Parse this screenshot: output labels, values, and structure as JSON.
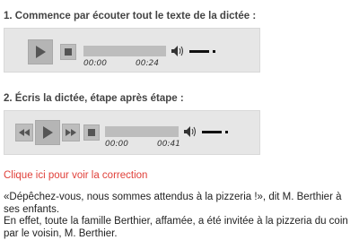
{
  "step1": {
    "heading": "1. Commence par écouter tout le texte de la dictée :",
    "player": {
      "current_time": "00:00",
      "duration": "00:24",
      "progress": 0
    }
  },
  "step2": {
    "heading": "2. Écris la dictée, étape après étape :",
    "player": {
      "current_time": "00:00",
      "duration": "00:41",
      "progress": 0
    }
  },
  "correction_link": "Clique ici pour voir la correction",
  "text": {
    "line1": "«Dépêchez-vous, nous sommes attendus à la pizzeria !», dit M. Berthier à ses enfants.",
    "line2": "En effet, toute la famille Berthier, affamée, a été invitée à la pizzeria du coin par le voisin, M. Berthier."
  },
  "icons": {
    "play": "play-icon",
    "stop": "stop-icon",
    "rewind": "rewind-icon",
    "forward": "fast-forward-icon",
    "volume": "volume-icon"
  },
  "colors": {
    "link": "#e0403a",
    "player_bg": "#e6e6e6",
    "button": "#b5b5b5"
  }
}
